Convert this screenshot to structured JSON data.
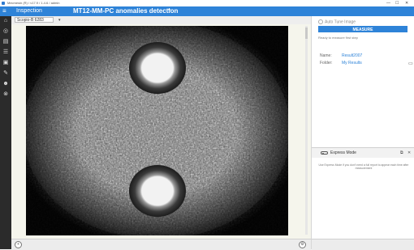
{
  "window": {
    "title": "Mecmesin (R) / v17.9 / 1.4.6 / admin",
    "minimize": "—",
    "maximize": "☐",
    "close": "✕"
  },
  "header": {
    "menu_icon": "hamburger-icon",
    "section": "Inspection",
    "title": "MT12-MM-PC anomalies detection",
    "dropdown_icon": "chevron-down-icon"
  },
  "nav": {
    "icons": [
      "home-icon",
      "target-icon",
      "book-icon",
      "list-icon",
      "image-gallery-icon",
      "wrench-icon",
      "users-icon",
      "close-circle-icon"
    ]
  },
  "toolbar": {
    "scope_label": "Scopio-B 6283",
    "scope_chevron": "chevron-down-icon"
  },
  "viewer": {
    "image_alt": "microscope view of textured surface with two circular features"
  },
  "bottom": {
    "left_icon": "add-circle-icon",
    "right_icon": "settings-circle-icon"
  },
  "panel": {
    "auto_tune_label": "Auto Tune Image",
    "measure_label": "MEASURE",
    "status": "Ready to measure first step",
    "name_label": "Name:",
    "name_value": "Result2007",
    "folder_label": "Folder:",
    "folder_value": "My Results",
    "folder_icon": "folder-icon",
    "express_label": "Express Mode",
    "express_desc": "Use Express Mode if you don't need a full report to appear each time after measurement"
  },
  "colors": {
    "accent": "#2e83d8",
    "nav_bg": "#2b2b2b"
  }
}
